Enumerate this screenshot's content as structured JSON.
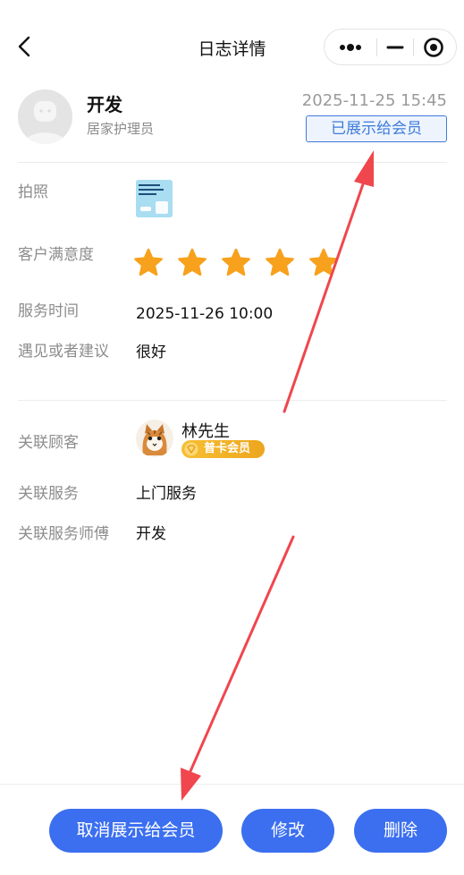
{
  "nav": {
    "title": "日志详情"
  },
  "author": {
    "name": "开发",
    "role": "居家护理员",
    "timestamp": "2025-11-25 15:45",
    "status_badge": "已展示给会员"
  },
  "fields": {
    "photo_label": "拍照",
    "satisfaction_label": "客户满意度",
    "satisfaction_rating": 5,
    "service_time_label": "服务时间",
    "service_time_value": "2025-11-26 10:00",
    "suggestion_label": "遇见或者建议",
    "suggestion_value": "很好"
  },
  "related": {
    "customer_label": "关联顾客",
    "customer_name": "林先生",
    "customer_tier": "普卡会员",
    "service_label": "关联服务",
    "service_value": "上门服务",
    "master_label": "关联服务师傅",
    "master_value": "开发"
  },
  "actions": {
    "cancel_show_label": "取消展示给会员",
    "edit_label": "修改",
    "delete_label": "删除"
  },
  "colors": {
    "primary": "#3b6ff0",
    "badge_border": "#3f7bdb",
    "star": "#f7a11c",
    "annotation_arrow": "#f0464d",
    "member_gold": "#f0aa22"
  },
  "icons": {
    "back": "chevron-left-icon",
    "more": "more-dots-icon",
    "minimize": "minimize-icon",
    "close": "target-close-icon",
    "star": "star-icon",
    "member": "diamond-icon"
  }
}
